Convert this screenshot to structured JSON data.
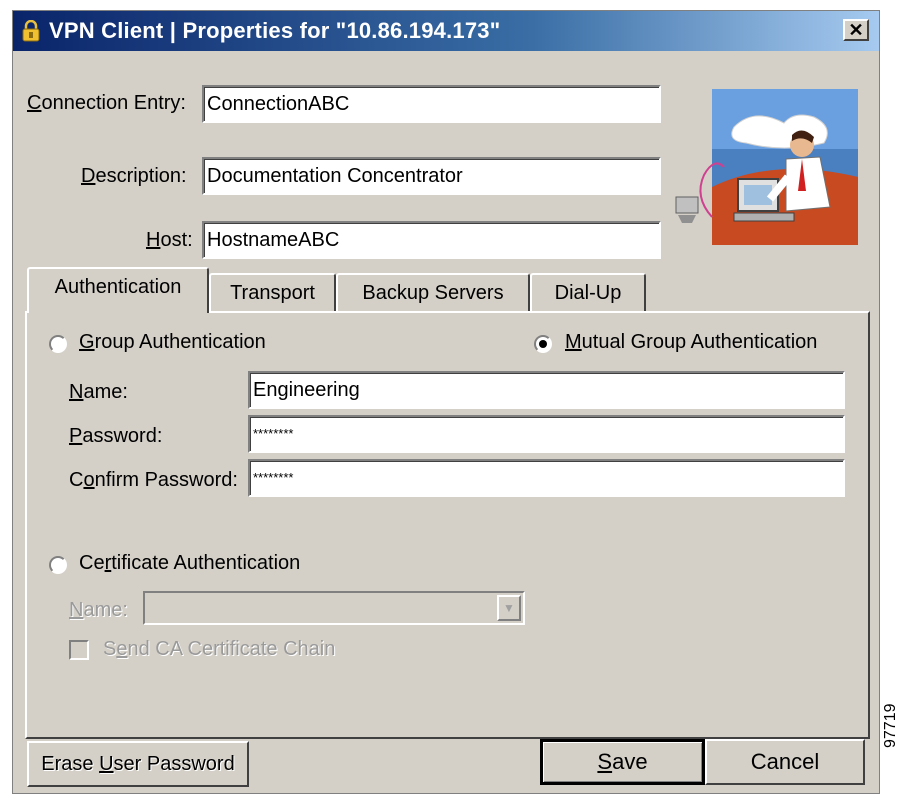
{
  "window": {
    "title": "VPN Client  |  Properties for \"10.86.194.173\"",
    "close_glyph": "✕"
  },
  "connection": {
    "entry_label_first": "C",
    "entry_label_rest": "onnection Entry:",
    "entry_value": "ConnectionABC",
    "description_label_first": "D",
    "description_label_rest": "escription:",
    "description_value": "Documentation Concentrator",
    "host_label_first": "H",
    "host_label_rest": "ost:",
    "host_value": "HostnameABC"
  },
  "tabs": [
    {
      "label": "Authentication",
      "active": true
    },
    {
      "label": "Transport",
      "active": false
    },
    {
      "label": "Backup Servers",
      "active": false
    },
    {
      "label": "Dial-Up",
      "active": false
    }
  ],
  "auth": {
    "group_auth_first": "G",
    "group_auth_rest": "roup Authentication",
    "mutual_auth_first": "M",
    "mutual_auth_rest": "utual Group Authentication",
    "selected": "mutual",
    "name_label_first": "N",
    "name_label_rest": "ame:",
    "name_value": "Engineering",
    "password_label_first": "P",
    "password_label_rest": "assword:",
    "password_value": "********",
    "confirm_label_a": "C",
    "confirm_label_u": "o",
    "confirm_label_rest": "nfirm Password:",
    "confirm_value": "********",
    "cert_auth_a": "Ce",
    "cert_auth_u": "r",
    "cert_auth_rest": "tificate Authentication",
    "cert_name_first": "N",
    "cert_name_rest": "ame:",
    "send_ca_a": "S",
    "send_ca_u": "e",
    "send_ca_rest": "nd CA Certificate Chain"
  },
  "buttons": {
    "erase_a": "Erase ",
    "erase_u": "U",
    "erase_rest": "ser Password",
    "save_u": "S",
    "save_rest": "ave",
    "cancel": "Cancel"
  },
  "figure_id": "97719",
  "colors": {
    "titlebar_start": "#0a246a",
    "titlebar_end": "#a6caf0",
    "dialog_face": "#d4d0c8"
  },
  "icons": {
    "title": "vpn-lock-icon",
    "close": "close-icon",
    "dropdown": "chevron-down-icon"
  }
}
